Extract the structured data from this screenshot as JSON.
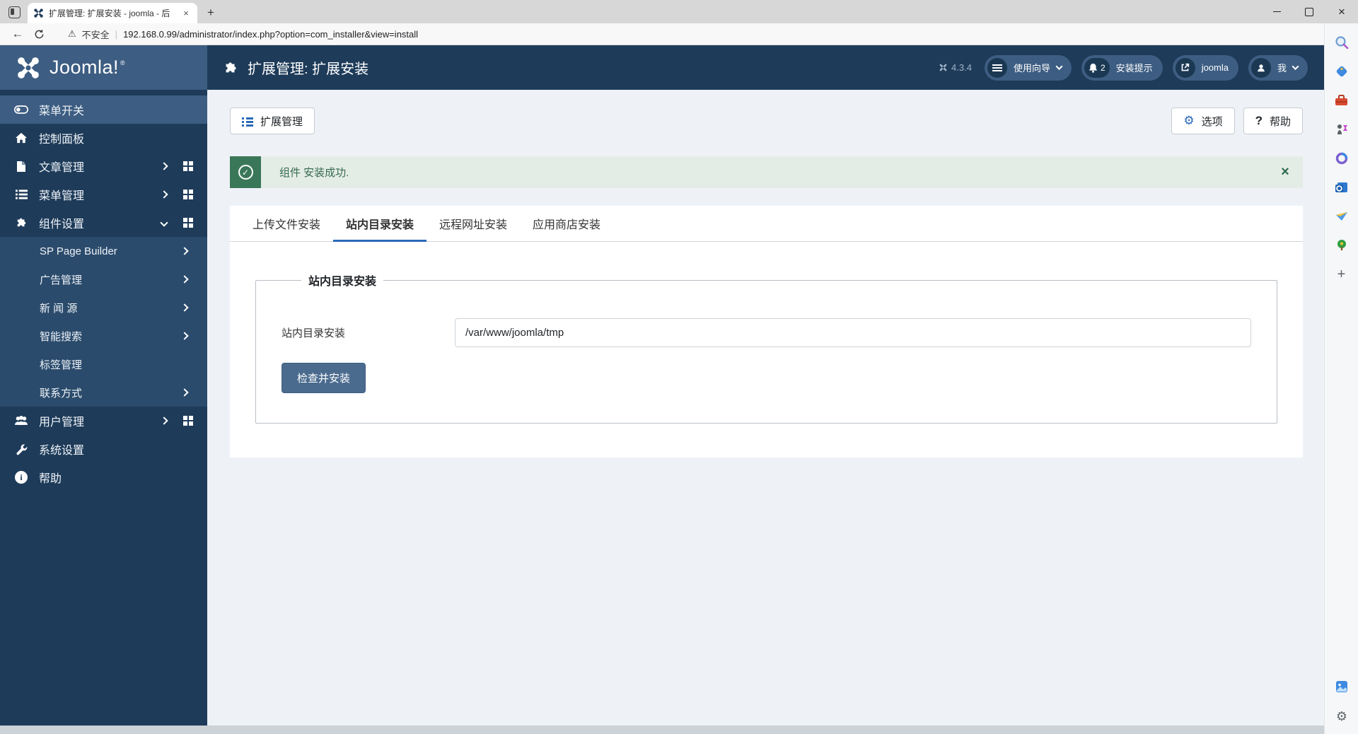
{
  "colors": {
    "header_navy": "#1e3b59",
    "logo_slate": "#3d5d82",
    "submenu_bg": "#2b4b6c",
    "accent_blue": "#2a69b8",
    "success_green": "#3a7758",
    "success_bg": "#e4ece6",
    "button_slate": "#4a6b8e",
    "content_bg": "#eef2f7"
  },
  "browser": {
    "tab_title": "扩展管理: 扩展安装 - joomla - 后",
    "security_label": "不安全",
    "url": "192.168.0.99/administrator/index.php?option=com_installer&view=install"
  },
  "edge_rail_icons": [
    "search",
    "shopping",
    "toolbox",
    "games",
    "microsoft-365",
    "outlook",
    "drop",
    "tree",
    "add",
    "image-creator",
    "settings"
  ],
  "header": {
    "logo_text": "Joomla!",
    "logo_reg": "®",
    "page_title": "扩展管理: 扩展安装",
    "version": "4.3.4",
    "pills": [
      {
        "label": "使用向导"
      },
      {
        "label": "安装提示",
        "badge": "2"
      },
      {
        "label": "joomla"
      },
      {
        "label": "我"
      }
    ]
  },
  "sidebar": {
    "items": [
      {
        "label": "菜单开关",
        "icon": "toggle-icon"
      },
      {
        "label": "控制面板",
        "icon": "home-icon"
      },
      {
        "label": "文章管理",
        "icon": "article-icon"
      },
      {
        "label": "菜单管理",
        "icon": "menus-icon"
      },
      {
        "label": "组件设置",
        "icon": "components-icon"
      },
      {
        "label": "用户管理",
        "icon": "users-icon"
      },
      {
        "label": "系统设置",
        "icon": "system-icon"
      },
      {
        "label": "帮助",
        "icon": "help-icon"
      }
    ],
    "submenu": [
      {
        "label": "SP Page Builder"
      },
      {
        "label": "广告管理"
      },
      {
        "label": "新 闻 源"
      },
      {
        "label": "智能搜索"
      },
      {
        "label": "标签管理"
      },
      {
        "label": "联系方式"
      }
    ]
  },
  "toolbar": {
    "extensions_label": "扩展管理",
    "options_label": "选项",
    "help_label": "帮助"
  },
  "alert": {
    "message": "组件 安装成功."
  },
  "tabs": [
    {
      "label": "上传文件安装"
    },
    {
      "label": "站内目录安装"
    },
    {
      "label": "远程网址安装"
    },
    {
      "label": "应用商店安装"
    }
  ],
  "form": {
    "legend": "站内目录安装",
    "field_label": "站内目录安装",
    "field_value": "/var/www/joomla/tmp",
    "submit_label": "检查并安装"
  }
}
